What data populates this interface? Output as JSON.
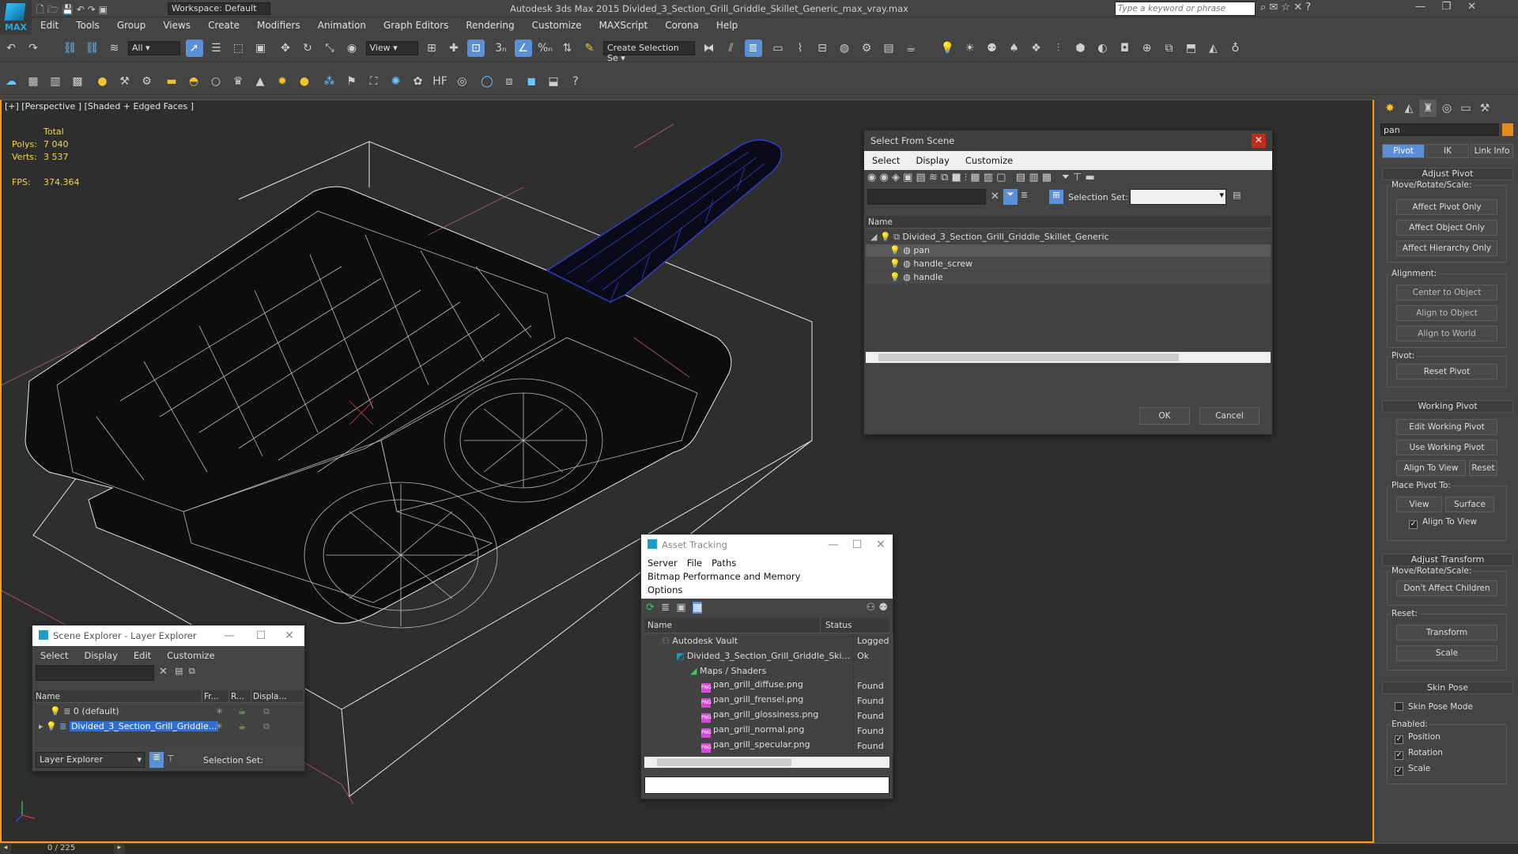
{
  "app": {
    "title": "Autodesk 3ds Max  2015    Divided_3_Section_Grill_Griddle_Skillet_Generic_max_vray.max",
    "logo_text": "MAX",
    "workspace": "Workspace: Default",
    "search_placeholder": "Type a keyword or phrase"
  },
  "menu": [
    "Edit",
    "Tools",
    "Group",
    "Views",
    "Create",
    "Modifiers",
    "Animation",
    "Graph Editors",
    "Rendering",
    "Customize",
    "MAXScript",
    "Corona",
    "Help"
  ],
  "toolbar": {
    "filter_value": "All",
    "view_value": "View",
    "selection_set_value": "Create Selection Se"
  },
  "viewport": {
    "label": "[+] [Perspective ] [Shaded + Edged Faces ]",
    "stats": {
      "total": "Total",
      "polys_label": "Polys:",
      "polys": "7 040",
      "verts_label": "Verts:",
      "verts": "3 537",
      "fps_label": "FPS:",
      "fps": "374.364"
    }
  },
  "command_panel": {
    "name_value": "pan",
    "tabs": [
      "Pivot",
      "IK",
      "Link Info"
    ],
    "rollouts": {
      "adjust_pivot": "Adjust Pivot",
      "move_rotate_scale": "Move/Rotate/Scale:",
      "affect_pivot_only": "Affect Pivot Only",
      "affect_object_only": "Affect Object Only",
      "affect_hierarchy_only": "Affect Hierarchy Only",
      "alignment": "Alignment:",
      "center_to_object": "Center to Object",
      "align_to_object": "Align to Object",
      "align_to_world": "Align to World",
      "pivot": "Pivot:",
      "reset_pivot": "Reset Pivot",
      "working_pivot": "Working Pivot",
      "edit_working_pivot": "Edit Working Pivot",
      "use_working_pivot": "Use Working Pivot",
      "align_to_view": "Align To View",
      "reset": "Reset",
      "place_pivot_to": "Place Pivot To:",
      "view": "View",
      "surface": "Surface",
      "align_to_view_cb": "Align To View",
      "adjust_transform": "Adjust Transform",
      "move_rotate_scale2": "Move/Rotate/Scale:",
      "dont_affect_children": "Don't Affect Children",
      "reset_label": "Reset:",
      "transform": "Transform",
      "scale": "Scale",
      "skin_pose": "Skin Pose",
      "skin_pose_mode": "Skin Pose Mode",
      "enabled": "Enabled:",
      "position": "Position",
      "rotation": "Rotation",
      "scale_cb": "Scale"
    }
  },
  "select_from_scene": {
    "title": "Select From Scene",
    "menu": [
      "Select",
      "Display",
      "Customize"
    ],
    "selection_set_label": "Selection Set:",
    "col_name": "Name",
    "root": "Divided_3_Section_Grill_Griddle_Skillet_Generic",
    "items": [
      "pan",
      "handle_screw",
      "handle"
    ],
    "ok": "OK",
    "cancel": "Cancel"
  },
  "asset_tracking": {
    "title": "Asset Tracking",
    "menu": [
      "Server",
      "File",
      "Paths",
      "Bitmap Performance and Memory",
      "Options"
    ],
    "col_name": "Name",
    "col_status": "Status",
    "rows": [
      {
        "name": "Autodesk Vault",
        "status": "Logged"
      },
      {
        "name": "Divided_3_Section_Grill_Griddle_Ski...",
        "status": "Ok"
      },
      {
        "name": "Maps / Shaders",
        "status": ""
      },
      {
        "name": "pan_grill_diffuse.png",
        "status": "Found"
      },
      {
        "name": "pan_grill_frensel.png",
        "status": "Found"
      },
      {
        "name": "pan_grill_glossiness.png",
        "status": "Found"
      },
      {
        "name": "pan_grill_normal.png",
        "status": "Found"
      },
      {
        "name": "pan_grill_specular.png",
        "status": "Found"
      }
    ]
  },
  "scene_explorer": {
    "title": "Scene Explorer - Layer Explorer",
    "menu": [
      "Select",
      "Display",
      "Edit",
      "Customize"
    ],
    "cols": [
      "Name",
      "Fr...",
      "R...",
      "Displa..."
    ],
    "rows": [
      "0 (default)",
      "Divided_3_Section_Grill_Griddle..."
    ],
    "explorer_value": "Layer Explorer",
    "selection_set_label": "Selection Set:"
  },
  "status": {
    "frame": "0 / 225"
  }
}
